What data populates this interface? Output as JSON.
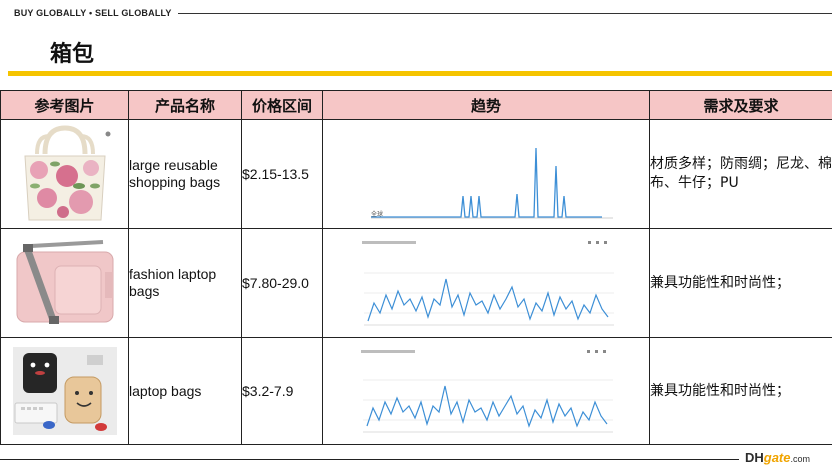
{
  "header": {
    "tagline": "BUY GLOBALLY • SELL GLOBALLY",
    "title": "箱包"
  },
  "table": {
    "columns": [
      "参考图片",
      "产品名称",
      "价格区间",
      "趋势",
      "需求及要求"
    ],
    "rows": [
      {
        "name": "large reusable shopping bags",
        "price": "$2.15-13.5",
        "requirement": "材质多样；防雨绸；尼龙、棉布、牛仔；PU",
        "trend_label": "全球"
      },
      {
        "name": "fashion laptop bags",
        "price": "$7.80-29.0",
        "requirement": "兼具功能性和时尚性；"
      },
      {
        "name": "laptop bags",
        "price": "$3.2-7.9",
        "requirement": "兼具功能性和时尚性；"
      }
    ]
  },
  "logo": {
    "dh": "DH",
    "gate": "gate",
    "com": ".com"
  }
}
